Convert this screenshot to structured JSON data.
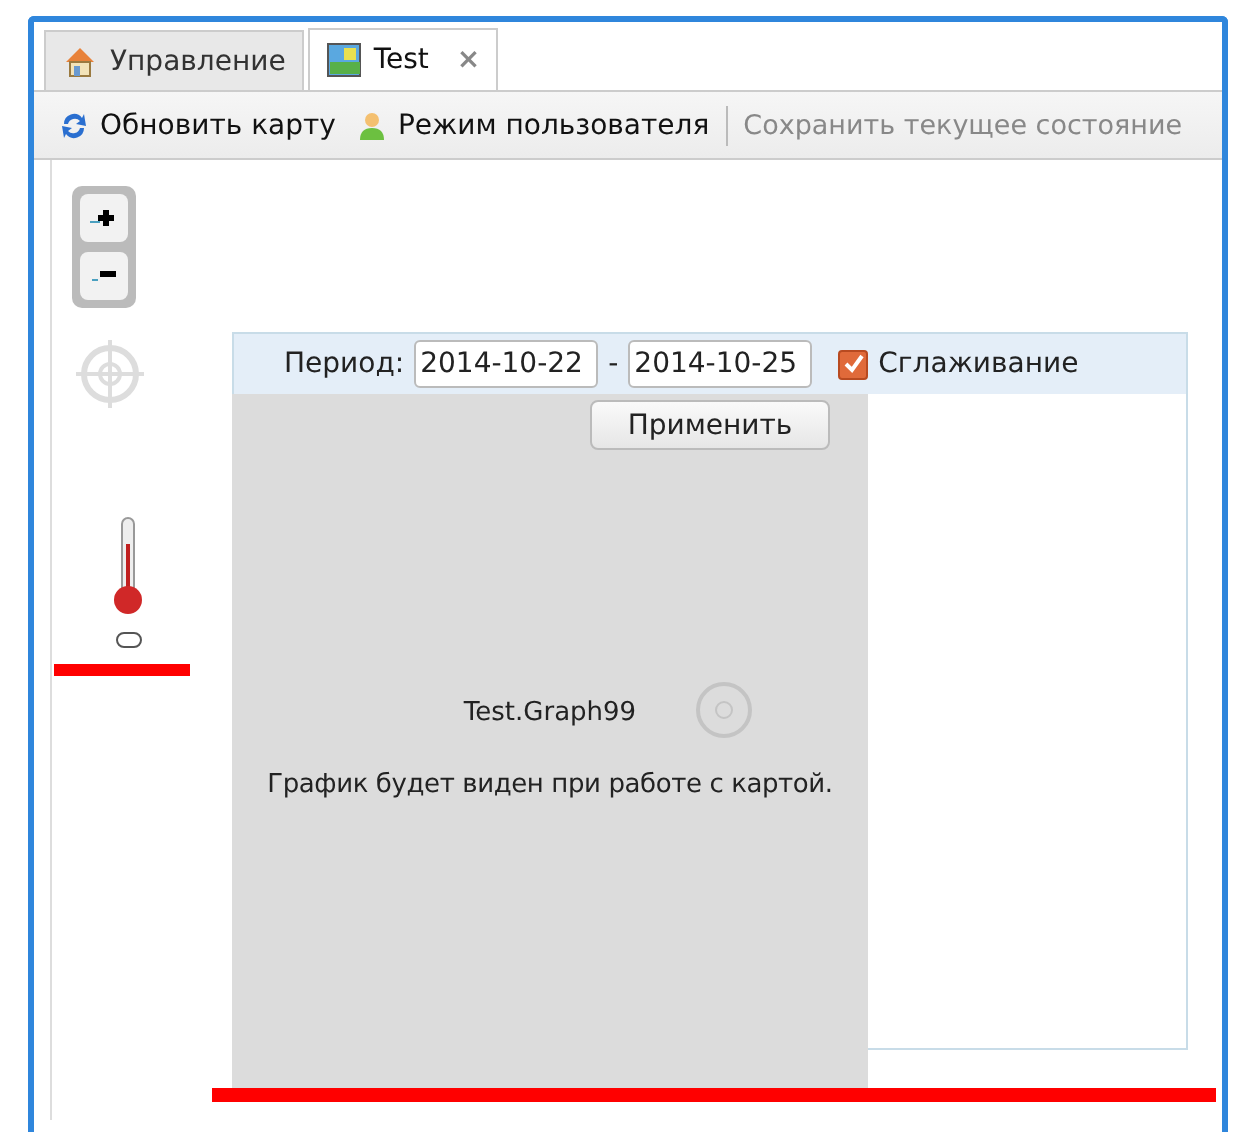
{
  "tabs": [
    {
      "label": "Управление",
      "selected": false
    },
    {
      "label": "Test",
      "selected": true,
      "close": "×"
    }
  ],
  "toolbar": [
    {
      "kind": "button",
      "label": "Обновить карту",
      "disabled": false
    },
    {
      "kind": "button",
      "label": "Режим пользователя",
      "disabled": false
    },
    {
      "kind": "separator"
    },
    {
      "kind": "button",
      "label": "Сохранить текущее состояние",
      "disabled": true
    }
  ],
  "graph_panel": {
    "period_label": "Период:",
    "date_from": "2014-10-22",
    "dash": "-",
    "date_to": "2014-10-25",
    "smoothing": {
      "label": "Сглаживание",
      "checked": true
    },
    "apply_button": "Применить",
    "graph_title": "Test.Graph99",
    "message": "График будет виден при работе с картой."
  }
}
